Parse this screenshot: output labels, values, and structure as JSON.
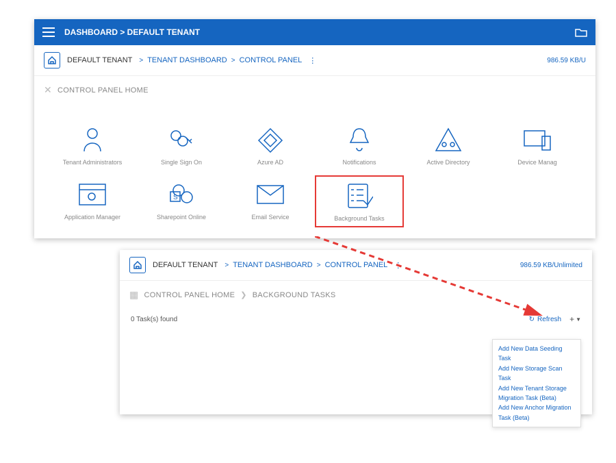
{
  "topbar": {
    "title": "DASHBOARD > DEFAULT TENANT"
  },
  "bc1": {
    "tenant": "DEFAULT TENANT",
    "dash": "TENANT DASHBOARD",
    "cp": "CONTROL PANEL",
    "quota": "986.59 KB/U"
  },
  "bc2": {
    "tenant": "DEFAULT TENANT",
    "dash": "TENANT DASHBOARD",
    "cp": "CONTROL PANEL",
    "quota": "986.59 KB/Unlimited"
  },
  "section1": {
    "title": "CONTROL PANEL HOME"
  },
  "section2": {
    "home": "CONTROL PANEL HOME",
    "bg": "BACKGROUND TASKS"
  },
  "items": {
    "tenadmin": "Tenant Administrators",
    "sso": "Single Sign On",
    "azuread": "Azure AD",
    "notif": "Notifications",
    "ad": "Active Directory",
    "devmgr": "Device Manag",
    "appmgr": "Application Manager",
    "spo": "Sharepoint Online",
    "email": "Email Service",
    "bgtasks": "Background Tasks"
  },
  "tasks": {
    "count": "0 Task(s) found",
    "refresh": "Refresh"
  },
  "menu": {
    "m1": "Add New Data Seeding Task",
    "m2": "Add New Storage Scan Task",
    "m3": "Add New Tenant Storage Migration Task (Beta)",
    "m4": "Add New Anchor Migration Task (Beta)"
  }
}
